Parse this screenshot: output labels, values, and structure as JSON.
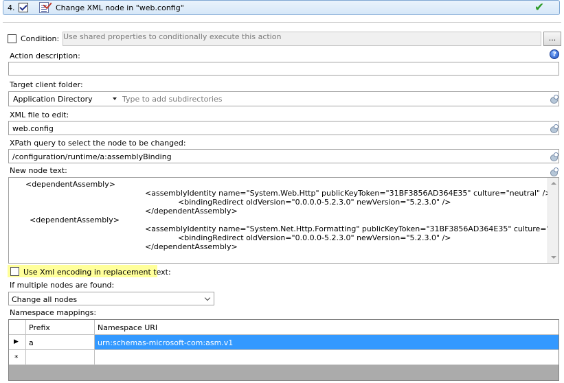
{
  "header": {
    "step_number": "4.",
    "title": "Change XML node in \"web.config\""
  },
  "condition": {
    "label": "Condition:",
    "placeholder": "Use shared properties to conditionally execute this action",
    "button_label": "..."
  },
  "action_description": {
    "label": "Action description:",
    "value": ""
  },
  "target_folder": {
    "label": "Target client folder:",
    "dropdown_value": "Application Directory",
    "subdir_placeholder": "Type to add subdirectories"
  },
  "xml_file": {
    "label": "XML file to edit:",
    "value": "web.config"
  },
  "xpath": {
    "label": "XPath query to select the node to be changed:",
    "value": "/configuration/runtime/a:assemblyBinding"
  },
  "node_text": {
    "label": "New node text:",
    "lines": [
      "<dependentAssembly>",
      "<assemblyIdentity name=\"System.Web.Http\" publicKeyToken=\"31BF3856AD364E35\" culture=\"neutral\" />",
      "<bindingRedirect oldVersion=\"0.0.0.0-5.2.3.0\" newVersion=\"5.2.3.0\" />",
      "</dependentAssembly>",
      "<dependentAssembly>",
      "<assemblyIdentity name=\"System.Net.Http.Formatting\" publicKeyToken=\"31BF3856AD364E35\" culture=\"neutral\" />",
      "<bindingRedirect oldVersion=\"0.0.0.0-5.2.3.0\" newVersion=\"5.2.3.0\" />",
      "</dependentAssembly>"
    ]
  },
  "xml_encoding": {
    "label": "Use Xml encoding in replacement text:",
    "checked": false
  },
  "multiple_nodes": {
    "label": "If multiple nodes are found:",
    "value": "Change all nodes"
  },
  "namespace_mappings": {
    "label": "Namespace mappings:",
    "columns": [
      "Prefix",
      "Namespace URI"
    ],
    "rows": [
      {
        "indicator": "▶",
        "prefix": "a",
        "uri": "urn:schemas-microsoft-com:asm.v1"
      },
      {
        "indicator": "*",
        "prefix": "",
        "uri": ""
      }
    ]
  },
  "colors": {
    "header_border": "#7fa7d3",
    "highlight": "#ffff9a",
    "selection": "#3399ff",
    "ok_check": "#2a9a24"
  }
}
